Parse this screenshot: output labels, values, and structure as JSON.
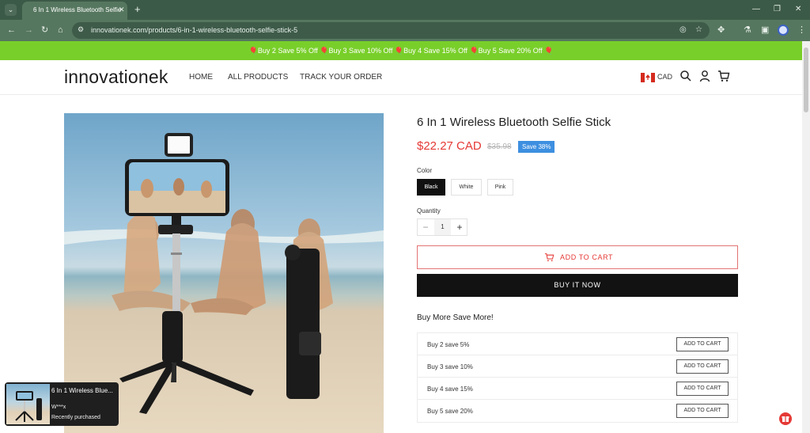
{
  "browser": {
    "tab_title": "6 In 1 Wireless Bluetooth Selfie",
    "url": "innovationek.com/products/6-in-1-wireless-bluetooth-selfie-stick-5"
  },
  "promo_bar": {
    "text": "🎈Buy 2 Save 5% Off 🎈Buy 3 Save 10% Off 🎈Buy 4 Save 15% Off 🎈Buy 5 Save 20% Off 🎈"
  },
  "header": {
    "logo": "innovationek",
    "nav": [
      "HOME",
      "ALL PRODUCTS",
      "TRACK YOUR ORDER"
    ],
    "currency": "CAD"
  },
  "product": {
    "title": "6 In 1 Wireless Bluetooth Selfie Stick",
    "price": "$22.27 CAD",
    "compare_price": "$35.98",
    "save_badge": "Save 38%",
    "color_label": "Color",
    "colors": [
      "Black",
      "White",
      "Pink"
    ],
    "selected_color": "Black",
    "quantity_label": "Quantity",
    "quantity": "1",
    "add_to_cart": "ADD TO CART",
    "buy_now": "BUY IT NOW"
  },
  "bundle": {
    "heading": "Buy More Save More!",
    "rows": [
      {
        "label": "Buy 2 save 5%",
        "button": "ADD TO CART"
      },
      {
        "label": "Buy 3 save 10%",
        "button": "ADD TO CART"
      },
      {
        "label": "Buy 4 save 15%",
        "button": "ADD TO CART"
      },
      {
        "label": "Buy 5 save 20%",
        "button": "ADD TO CART"
      }
    ]
  },
  "purchase_popup": {
    "title": "6 In 1 Wireless Blue...",
    "user": "W***x",
    "status": "Recently purchased"
  },
  "colors": {
    "promo_green": "#79cf2a",
    "price_red": "#e53935",
    "badge_blue": "#3d8fe0",
    "chrome_green": "#56775f"
  }
}
